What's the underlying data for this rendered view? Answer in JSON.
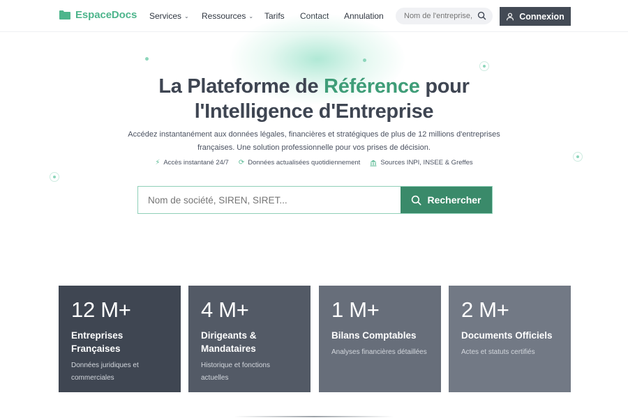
{
  "brand": {
    "name": "EspaceDocs",
    "color": "#4db58c"
  },
  "nav": {
    "items": [
      {
        "label": "Services",
        "dropdown": true
      },
      {
        "label": "Ressources",
        "dropdown": true
      },
      {
        "label": "Tarifs",
        "dropdown": false
      },
      {
        "label": "Contact",
        "dropdown": false
      },
      {
        "label": "Annulation",
        "dropdown": false
      }
    ],
    "search_placeholder": "Nom de l'entreprise, S",
    "login_label": "Connexion"
  },
  "hero": {
    "title_part1": "La Plateforme de ",
    "title_accent": "Référence",
    "title_part2": " pour",
    "title_line2": "l'Intelligence d'Entreprise",
    "subtitle": "Accédez instantanément aux données légales, financières et stratégiques de plus de 12 millions d'entreprises françaises. Une solution professionnelle pour vos prises de décision.",
    "features": [
      {
        "icon": "bolt-icon",
        "label": "Accès instantané 24/7"
      },
      {
        "icon": "refresh-icon",
        "label": "Données actualisées quotidiennement"
      },
      {
        "icon": "bank-icon",
        "label": "Sources INPI, INSEE & Greffes"
      }
    ],
    "search_placeholder": "Nom de société, SIREN, SIRET...",
    "search_button": "Rechercher",
    "accent_color": "#3f9d78"
  },
  "stats": [
    {
      "value": "12 M+",
      "label": "Entreprises Françaises",
      "desc": "Données juridiques et commerciales",
      "color": "#3f4652"
    },
    {
      "value": "4 M+",
      "label": "Dirigeants & Mandataires",
      "desc": "Historique et fonctions actuelles",
      "color": "#535a66"
    },
    {
      "value": "1 M+",
      "label": "Bilans Comptables",
      "desc": "Analyses financières détaillées",
      "color": "#676e7a"
    },
    {
      "value": "2 M+",
      "label": "Documents Officiels",
      "desc": "Actes et statuts certifiés",
      "color": "#727985"
    }
  ]
}
